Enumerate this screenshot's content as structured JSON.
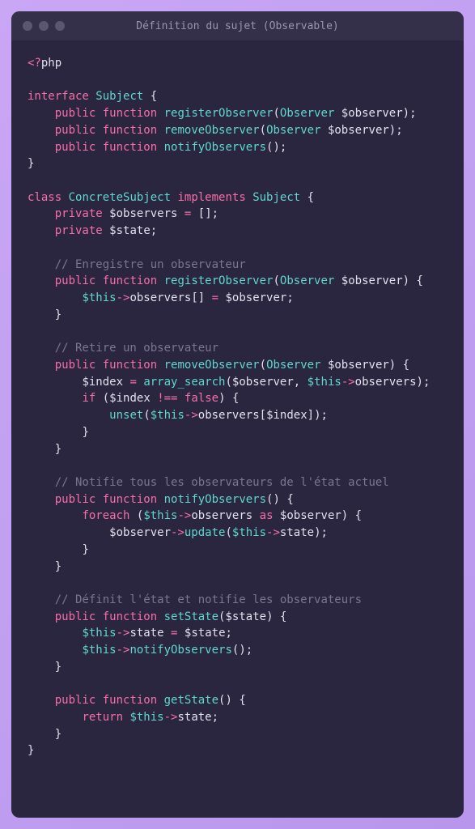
{
  "window": {
    "title": "Définition du sujet (Observable)"
  },
  "code": {
    "phpOpen1": "<?",
    "phpOpen2": "php",
    "kwInterface": "interface",
    "typeSubject": "Subject",
    "kwPublic": "public",
    "kwFunction": "function",
    "fnRegisterObserver": "registerObserver",
    "typeObserver": "Observer",
    "varObserver": "$observer",
    "fnRemoveObserver": "removeObserver",
    "fnNotifyObservers": "notifyObservers",
    "kwClass": "class",
    "typeConcreteSubject": "ConcreteSubject",
    "kwImplements": "implements",
    "kwPrivate": "private",
    "varObservers": "$observers",
    "emptyArray": "[]",
    "varState": "$state",
    "comment1": "// Enregistre un observateur",
    "this": "$this",
    "arrow": "->",
    "propObservers": "observers",
    "bracketPush": "[]",
    "comment2": "// Retire un observateur",
    "varIndex": "$index",
    "fnArraySearch": "array_search",
    "kwIf": "if",
    "opNeq": "!==",
    "valFalse": "false",
    "fnUnset": "unset",
    "comment3": "// Notifie tous les observateurs de l'état actuel",
    "kwForeach": "foreach",
    "kwAs": "as",
    "fnUpdate": "update",
    "propState": "state",
    "comment4": "// Définit l'état et notifie les observateurs",
    "fnSetState": "setState",
    "fnGetState": "getState",
    "kwReturn": "return"
  }
}
